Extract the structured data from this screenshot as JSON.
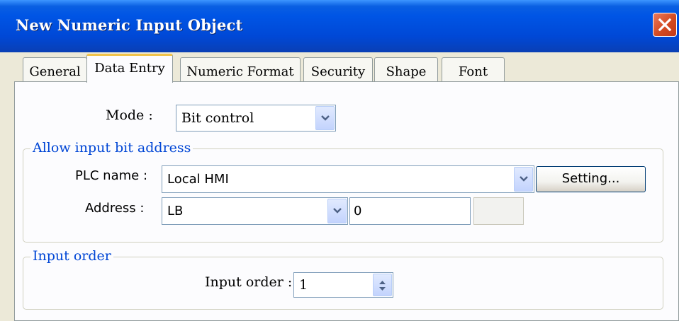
{
  "window": {
    "title": "New  Numeric Input Object"
  },
  "tabs": [
    {
      "label": "General"
    },
    {
      "label": "Data Entry"
    },
    {
      "label": "Numeric Format"
    },
    {
      "label": "Security"
    },
    {
      "label": "Shape"
    },
    {
      "label": "Font"
    }
  ],
  "mode": {
    "label": "Mode :",
    "value": "Bit control"
  },
  "allow_input": {
    "legend": "Allow input bit address",
    "plc_label": "PLC name :",
    "plc_value": "Local HMI",
    "setting_button": "Setting...",
    "address_label": "Address :",
    "address_device": "LB",
    "address_number": "0",
    "address_extra": ""
  },
  "input_order_group": {
    "legend": "Input order",
    "label": "Input order :",
    "value": "1"
  },
  "colors": {
    "title_bar": "#0055e5",
    "legend_text": "#0046d5",
    "active_tab_accent": "#f0c34a"
  }
}
